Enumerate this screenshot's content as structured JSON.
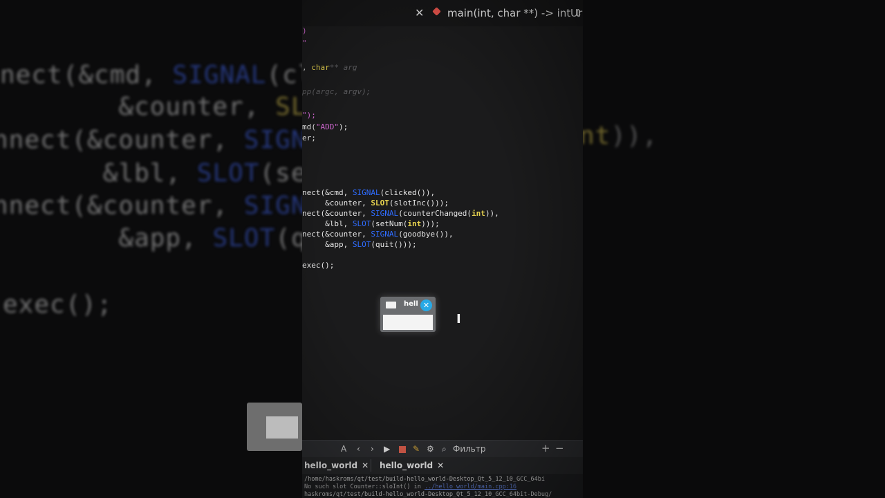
{
  "background": {
    "left_lines": [
      {
        "a": "nect(&cmd, ",
        "b": "SIGNAL",
        "c": "(cl"
      },
      {
        "a": "        &counter, ",
        "b": "SLOT",
        "c": "("
      },
      {
        "a": "nnect(&counter, ",
        "b": "SIGNA",
        "c": ""
      },
      {
        "a": "       &lbl, ",
        "b": "SLOT",
        "c": "(setM"
      },
      {
        "a": "nnect(&counter, ",
        "b": "SIGNA",
        "c": ""
      },
      {
        "a": "        &app, ",
        "b": "SLOT",
        "c": "(qui"
      },
      {
        "a": "exec();",
        "b": "",
        "c": ""
      }
    ],
    "right_line": {
      "a": "nt",
      "b": ")),"
    }
  },
  "editor": {
    "close_glyph": "✕",
    "function_selector": "main(int, char **) -> int ⇕",
    "tail_text": "Ur"
  },
  "code": {
    "l1": ")",
    "l2": "\"",
    "l3a": ", ",
    "l3b": "char",
    "l3c": "** arg",
    "l4": "pp(argc, argv);",
    "l5": "\");",
    "l6a": "md(",
    "l6b": "\"ADD\"",
    "l6c": ");",
    "l7": "er;",
    "c1a": "nect(&cmd, ",
    "c1b": "SIGNAL",
    "c1c": "(clicked()),",
    "c2a": "     &counter, ",
    "c2b": "SLOT",
    "c2c": "(slotInc()));",
    "c3a": "nect(&counter, ",
    "c3b": "SIGNAL",
    "c3c": "(counterChanged(",
    "c3d": "int",
    "c3e": ")),",
    "c4a": "     &lbl, ",
    "c4b": "SLOT",
    "c4c": "(setNum(",
    "c4d": "int",
    "c4e": ")));",
    "c5a": "nect(&counter, ",
    "c5b": "SIGNAL",
    "c5c": "(goodbye()),",
    "c6a": "     &app, ",
    "c6b": "SLOT",
    "c6c": "(quit()));",
    "c7": "exec();"
  },
  "mini_window": {
    "title": "hell",
    "close": "✕"
  },
  "cursor_glyph": "I",
  "toolbar": {
    "icon_font": "A",
    "prev": "‹",
    "next": "›",
    "run": "▶",
    "filter_label": "Фильтр",
    "plus": "+",
    "minus": "−"
  },
  "tabs": [
    {
      "label": "hello_world",
      "close": "✕"
    },
    {
      "label": "hello_world",
      "close": "✕"
    }
  ],
  "output": {
    "line1": "/home/haskroms/qt/test/build-hello_world-Desktop_Qt_5_12_10_GCC_64bi",
    "line2a": "No such slot Counter::sloInt() in ",
    "line2b": "../hello_world/main.cpp:16",
    "line3": "haskroms/qt/test/build-hello_world-Desktop_Qt_5_12_10_GCC_64bit-Debug/"
  }
}
